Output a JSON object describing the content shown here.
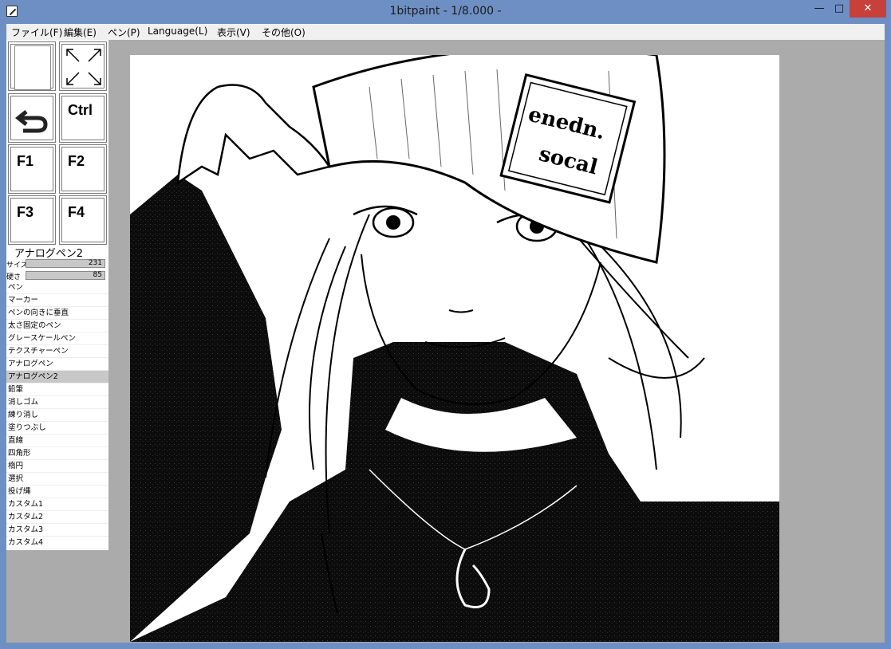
{
  "window": {
    "title": "1bitpaint - 1/8.000 -"
  },
  "menu": [
    "ファイル(F)",
    "編集(E)",
    "ペン(P)",
    "Language(L)",
    "表示(V)",
    "その他(O)"
  ],
  "tools": {
    "ctrl": "Ctrl",
    "f1": "F1",
    "f2": "F2",
    "f3": "F3",
    "f4": "F4"
  },
  "pen": {
    "current": "アナログペン2",
    "size_label": "サイズ",
    "size_value": "231",
    "hardness_label": "硬さ",
    "hardness_value": "85",
    "list": [
      "ペン",
      "マーカー",
      "ペンの向きに垂直",
      "太さ固定のペン",
      "グレースケールペン",
      "テクスチャーペン",
      "アナログペン",
      "アナログペン2",
      "鉛筆",
      "消しゴム",
      "練り消し",
      "塗りつぶし",
      "直線",
      "四角形",
      "楕円",
      "選択",
      "投げ縄",
      "カスタム1",
      "カスタム2",
      "カスタム3",
      "カスタム4"
    ],
    "selected_index": 7
  },
  "canvas_text": {
    "hat_patch_line1": "enedn.",
    "hat_patch_line2": "socal"
  },
  "colors": {
    "titlebar": "#6d8fc4",
    "close": "#c7403a",
    "workspace": "#ababab"
  }
}
